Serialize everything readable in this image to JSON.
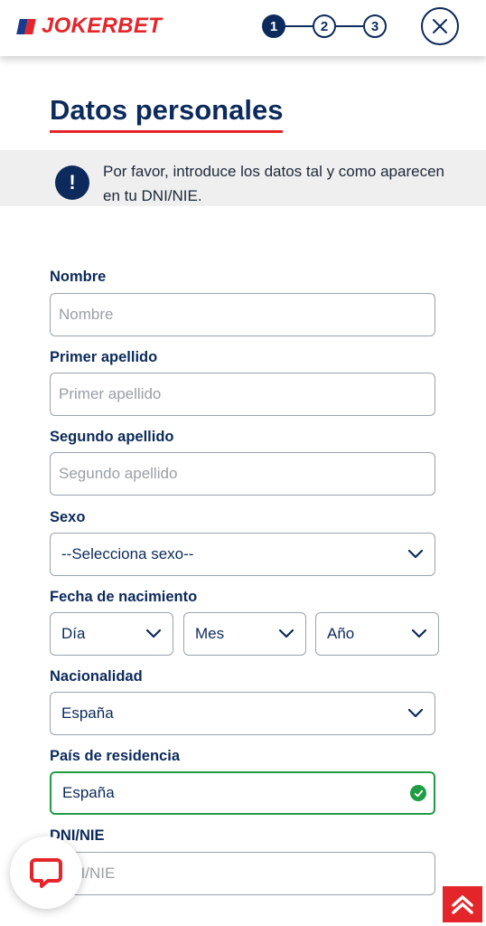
{
  "brand": {
    "name": "JOKERBET",
    "red": "#e4262b",
    "navy": "#0c2a5b",
    "blue": "#1a3a8f"
  },
  "steps": [
    {
      "label": "1",
      "active": true
    },
    {
      "label": "2",
      "active": false
    },
    {
      "label": "3",
      "active": false
    }
  ],
  "header": {
    "close_icon": "close-icon"
  },
  "page": {
    "title": "Datos personales"
  },
  "banner": {
    "icon_text": "!",
    "text": "Por favor, introduce los datos tal y como aparecen en tu DNI/NIE."
  },
  "form": {
    "nombre": {
      "label": "Nombre",
      "placeholder": "Nombre",
      "value": ""
    },
    "primer_apellido": {
      "label": "Primer apellido",
      "placeholder": "Primer apellido",
      "value": ""
    },
    "segundo_apellido": {
      "label": "Segundo apellido",
      "placeholder": "Segundo apellido",
      "value": ""
    },
    "sexo": {
      "label": "Sexo",
      "selected": "--Selecciona sexo--"
    },
    "fecha": {
      "label": "Fecha de nacimiento",
      "dia": "Día",
      "mes": "Mes",
      "ano": "Año"
    },
    "nacionalidad": {
      "label": "Nacionalidad",
      "selected": "España"
    },
    "pais_residencia": {
      "label": "País de residencia",
      "selected": "España",
      "valid_color": "#1f9d45"
    },
    "dni": {
      "label": "DNI/NIE",
      "placeholder": "DNI/NIE"
    }
  }
}
